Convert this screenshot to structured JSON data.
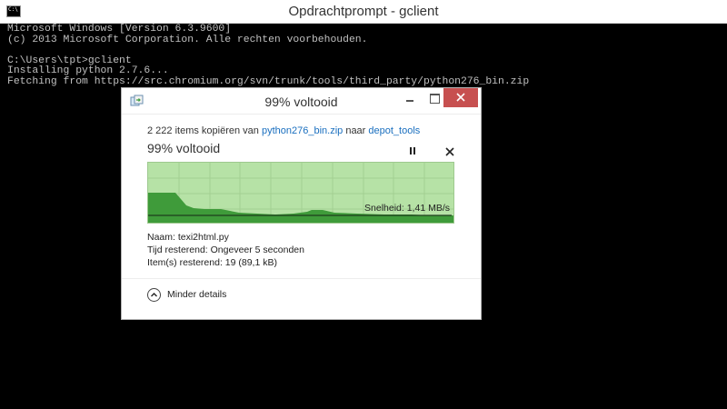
{
  "console": {
    "title": "Opdrachtprompt - gclient",
    "icon_text": "C:\\",
    "lines": [
      "Microsoft Windows [Version 6.3.9600]",
      "(c) 2013 Microsoft Corporation. Alle rechten voorbehouden.",
      "",
      "C:\\Users\\tpt>gclient",
      "Installing python 2.7.6...",
      "Fetching from https://src.chromium.org/svn/trunk/tools/third_party/python276_bin.zip"
    ]
  },
  "dialog": {
    "title": "99% voltooid",
    "copy_prefix": "2 222 items kopiëren van ",
    "source": "python276_bin.zip",
    "copy_middle": " naar ",
    "destination": "depot_tools",
    "heading": "99% voltooid",
    "progress_percent": 99,
    "speed": "Snelheid: 1,41 MB/s",
    "name_label": "Naam: ",
    "name_value": "texi2html.py",
    "time_label": "Tijd resterend:  ",
    "time_value": "Ongeveer 5 seconden",
    "items_label": "Item(s) resterend:  ",
    "items_value": "19 (89,1 kB)",
    "toggle_label": "Minder details"
  },
  "colors": {
    "graph_background": "#b6e2a6",
    "graph_fill": "#3f9b3a",
    "close_button": "#c75050",
    "link": "#1a6fbf"
  },
  "icons": {
    "console": "console-icon",
    "dialog": "copy-files-icon",
    "pause": "pause-icon",
    "cancel": "close-icon",
    "toggle": "chevron-up-icon"
  }
}
